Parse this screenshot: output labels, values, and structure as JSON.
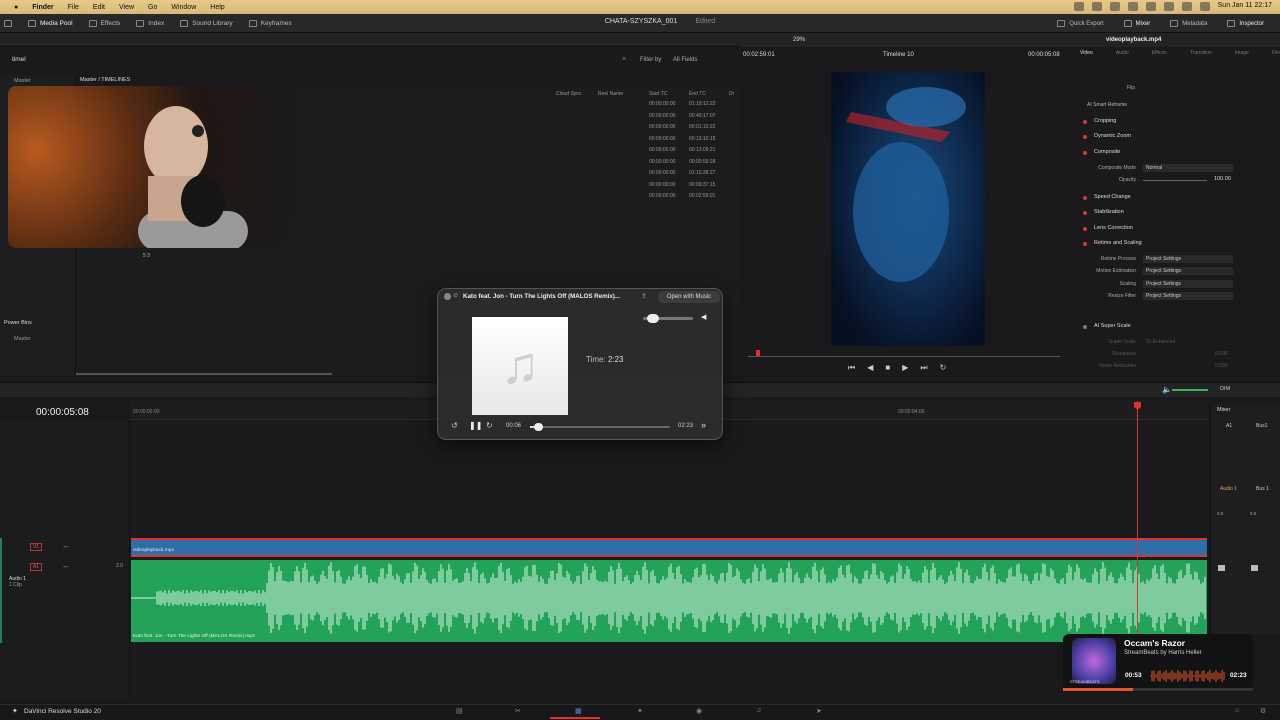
{
  "menubar": {
    "apple": "",
    "items": [
      "Finder",
      "File",
      "Edit",
      "View",
      "Go",
      "Window",
      "Help"
    ],
    "datetime": "Sun Jan 11  22:17"
  },
  "toolbar": {
    "left": [
      "Media Pool",
      "Effects",
      "Index",
      "Sound Library",
      "Keyframes"
    ],
    "project": "CHATA-SZYSZKA_001",
    "edited": "Edited",
    "right": [
      "Quick Export",
      "Mixer",
      "Metadata",
      "Inspector"
    ]
  },
  "media_pool": {
    "search": "timel",
    "filter_label": "Filter by",
    "filter_value": "All Fields",
    "bin_root": "Master",
    "breadcrumb": "Master / TIMELINES",
    "columns": [
      "Cloud Sync",
      "Reel Name",
      "Start TC",
      "End TC",
      "Dr"
    ],
    "start_tc": [
      "00:00:00:00",
      "00:00:00:00",
      "00:00:00:00",
      "00:00:00:00",
      "00:00:00:00",
      "00:00:00:00",
      "00:00:00:00",
      "00:00:00:00",
      "00:00:00:00"
    ],
    "end_tc": [
      "01:19:12:22",
      "00:40:17:07",
      "00:01:10:22",
      "00:13:10:15",
      "00:13:09:21",
      "00:00:59:28",
      "01:15:28:27",
      "00:00:37:15",
      "00:02:59:01"
    ],
    "viewer_badge": "5  3",
    "power_bins": "Power Bins",
    "power_bins_master": "Master"
  },
  "viewer": {
    "zoom": "29%",
    "timecode": "00:02:59:01",
    "timeline_name": "Timeline 10",
    "timecode_right": "00:00:05:08"
  },
  "inspector": {
    "file": "videoplayback.mp4",
    "tabs": [
      "Video",
      "Audio",
      "Effects",
      "Transition",
      "Image",
      "File"
    ],
    "flip": "Flip",
    "ai_smart_reframe": "AI Smart Reframe",
    "sections": [
      "Cropping",
      "Dynamic Zoom",
      "Composite",
      "Speed Change",
      "Stabilization",
      "Lens Correction",
      "Retime and Scaling",
      "AI Super Scale"
    ],
    "composite_mode_label": "Composite Mode",
    "composite_mode": "Normal",
    "opacity_label": "Opacity",
    "opacity": "100.00",
    "retime_labels": [
      "Retime Process",
      "Motion Estimation",
      "Scaling",
      "Resize Filter"
    ],
    "retime_values": [
      "Project Settings",
      "Project Settings",
      "Project Settings",
      "Project Settings"
    ],
    "super_scale_label": "Super Scale",
    "super_scale_value": "2x Enhanced",
    "sharpness_label": "Sharpness",
    "sharpness_value": "0.500",
    "noise_label": "Noise Reduction",
    "noise_value": "0.500"
  },
  "timeline": {
    "timecode": "00:00:05:08",
    "ruler": [
      "00:00:00:00",
      "00:00:04:00"
    ],
    "v1": "V1",
    "a1": "A1",
    "audio_track_name": "Audio 1",
    "audio_track_clips": "1 Clip",
    "audio_level": "2.0",
    "video_clip": "videoplayback.mp4",
    "audio_clip": "Kato feat. Jon - Turn The Lights Off (MALOS Remix).mp3",
    "dim": "DIM"
  },
  "mixer": {
    "title": "Mixer",
    "a1": "A1",
    "bus1": "Bus1",
    "audio1": "Audio 1",
    "bus1b": "Bus 1",
    "level_a": "0.0",
    "level_b": "0.0"
  },
  "player": {
    "title": "Kato feat. Jon - Turn The Lights Off (MALOS Remix)...",
    "open_button": "Open with Music",
    "time_label": "Time:",
    "time_value": "2:23",
    "elapsed": "00:06",
    "duration": "02:23",
    "progress": 0.04,
    "volume": 0.2
  },
  "streambeats": {
    "title": "Occam's Razor",
    "artist": "StreamBeats by Harris Heller",
    "elapsed": "00:53",
    "duration": "02:23",
    "brand": "STREAMBEATS",
    "progress": 0.37,
    "accent": "#e8552b"
  },
  "bottom": {
    "app_name": "DaVinci Resolve Studio 20"
  },
  "colors": {
    "video_clip": "#2f6ea8",
    "audio_clip": "#23a35a",
    "playhead": "#e03030"
  }
}
